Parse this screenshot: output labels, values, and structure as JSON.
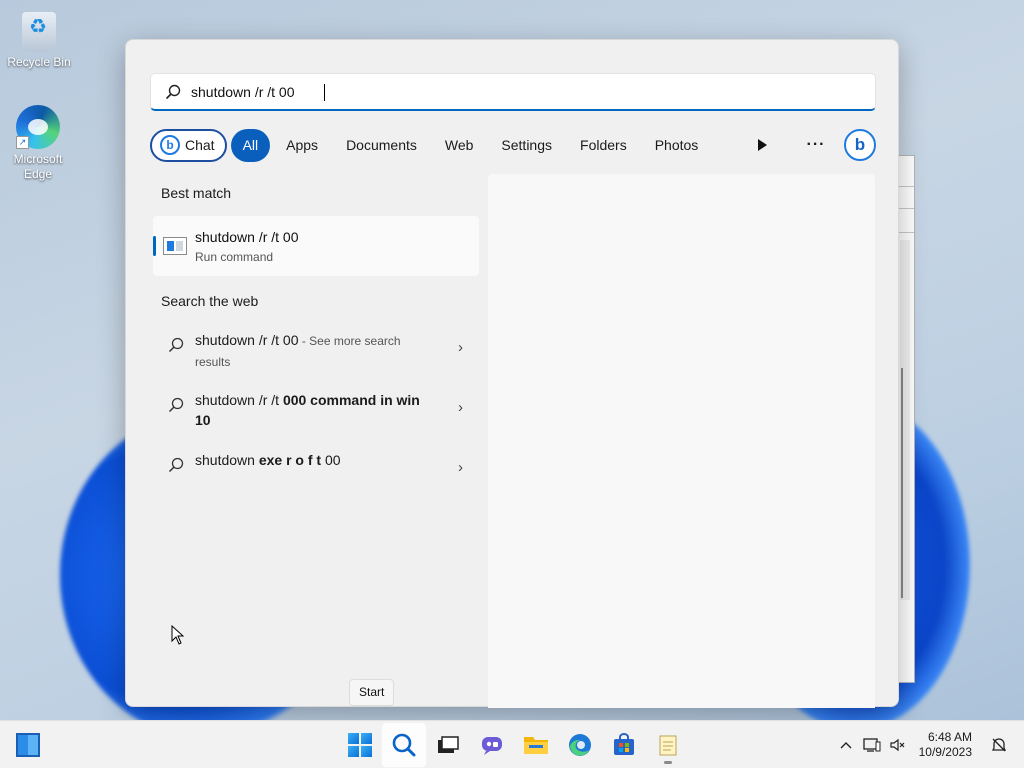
{
  "desktop": {
    "icons": [
      {
        "label": "Recycle Bin",
        "icon": "recycle-bin-icon"
      },
      {
        "label": "Microsoft Edge",
        "icon": "edge-icon"
      }
    ]
  },
  "search": {
    "query": "shutdown /r /t 00",
    "filters": {
      "chat": "Chat",
      "all": "All",
      "apps": "Apps",
      "documents": "Documents",
      "web": "Web",
      "settings": "Settings",
      "folders": "Folders",
      "photos": "Photos",
      "more": "···"
    },
    "best_match": {
      "heading": "Best match",
      "title": "shutdown /r /t 00",
      "subtitle": "Run command"
    },
    "web": {
      "heading": "Search the web",
      "items": [
        {
          "main": "shutdown /r /t 00",
          "suffix": " - See more search results"
        },
        {
          "main": "shutdown /r /t ",
          "bold": "000 command in win 10"
        },
        {
          "main": "shutdown ",
          "bold": "exe r o f t",
          "tail": " 00"
        }
      ]
    },
    "tooltip": "Start"
  },
  "taskbar": {
    "apps": [
      "widgets-icon",
      "start-icon",
      "search-icon",
      "task-view-icon",
      "chat-icon",
      "file-explorer-icon",
      "edge-icon",
      "store-icon",
      "notepad-icon"
    ],
    "clock_time": "6:48 AM",
    "clock_date": "10/9/2023"
  },
  "colors": {
    "accent": "#0067c0",
    "active_filter": "#0a5fbd"
  }
}
